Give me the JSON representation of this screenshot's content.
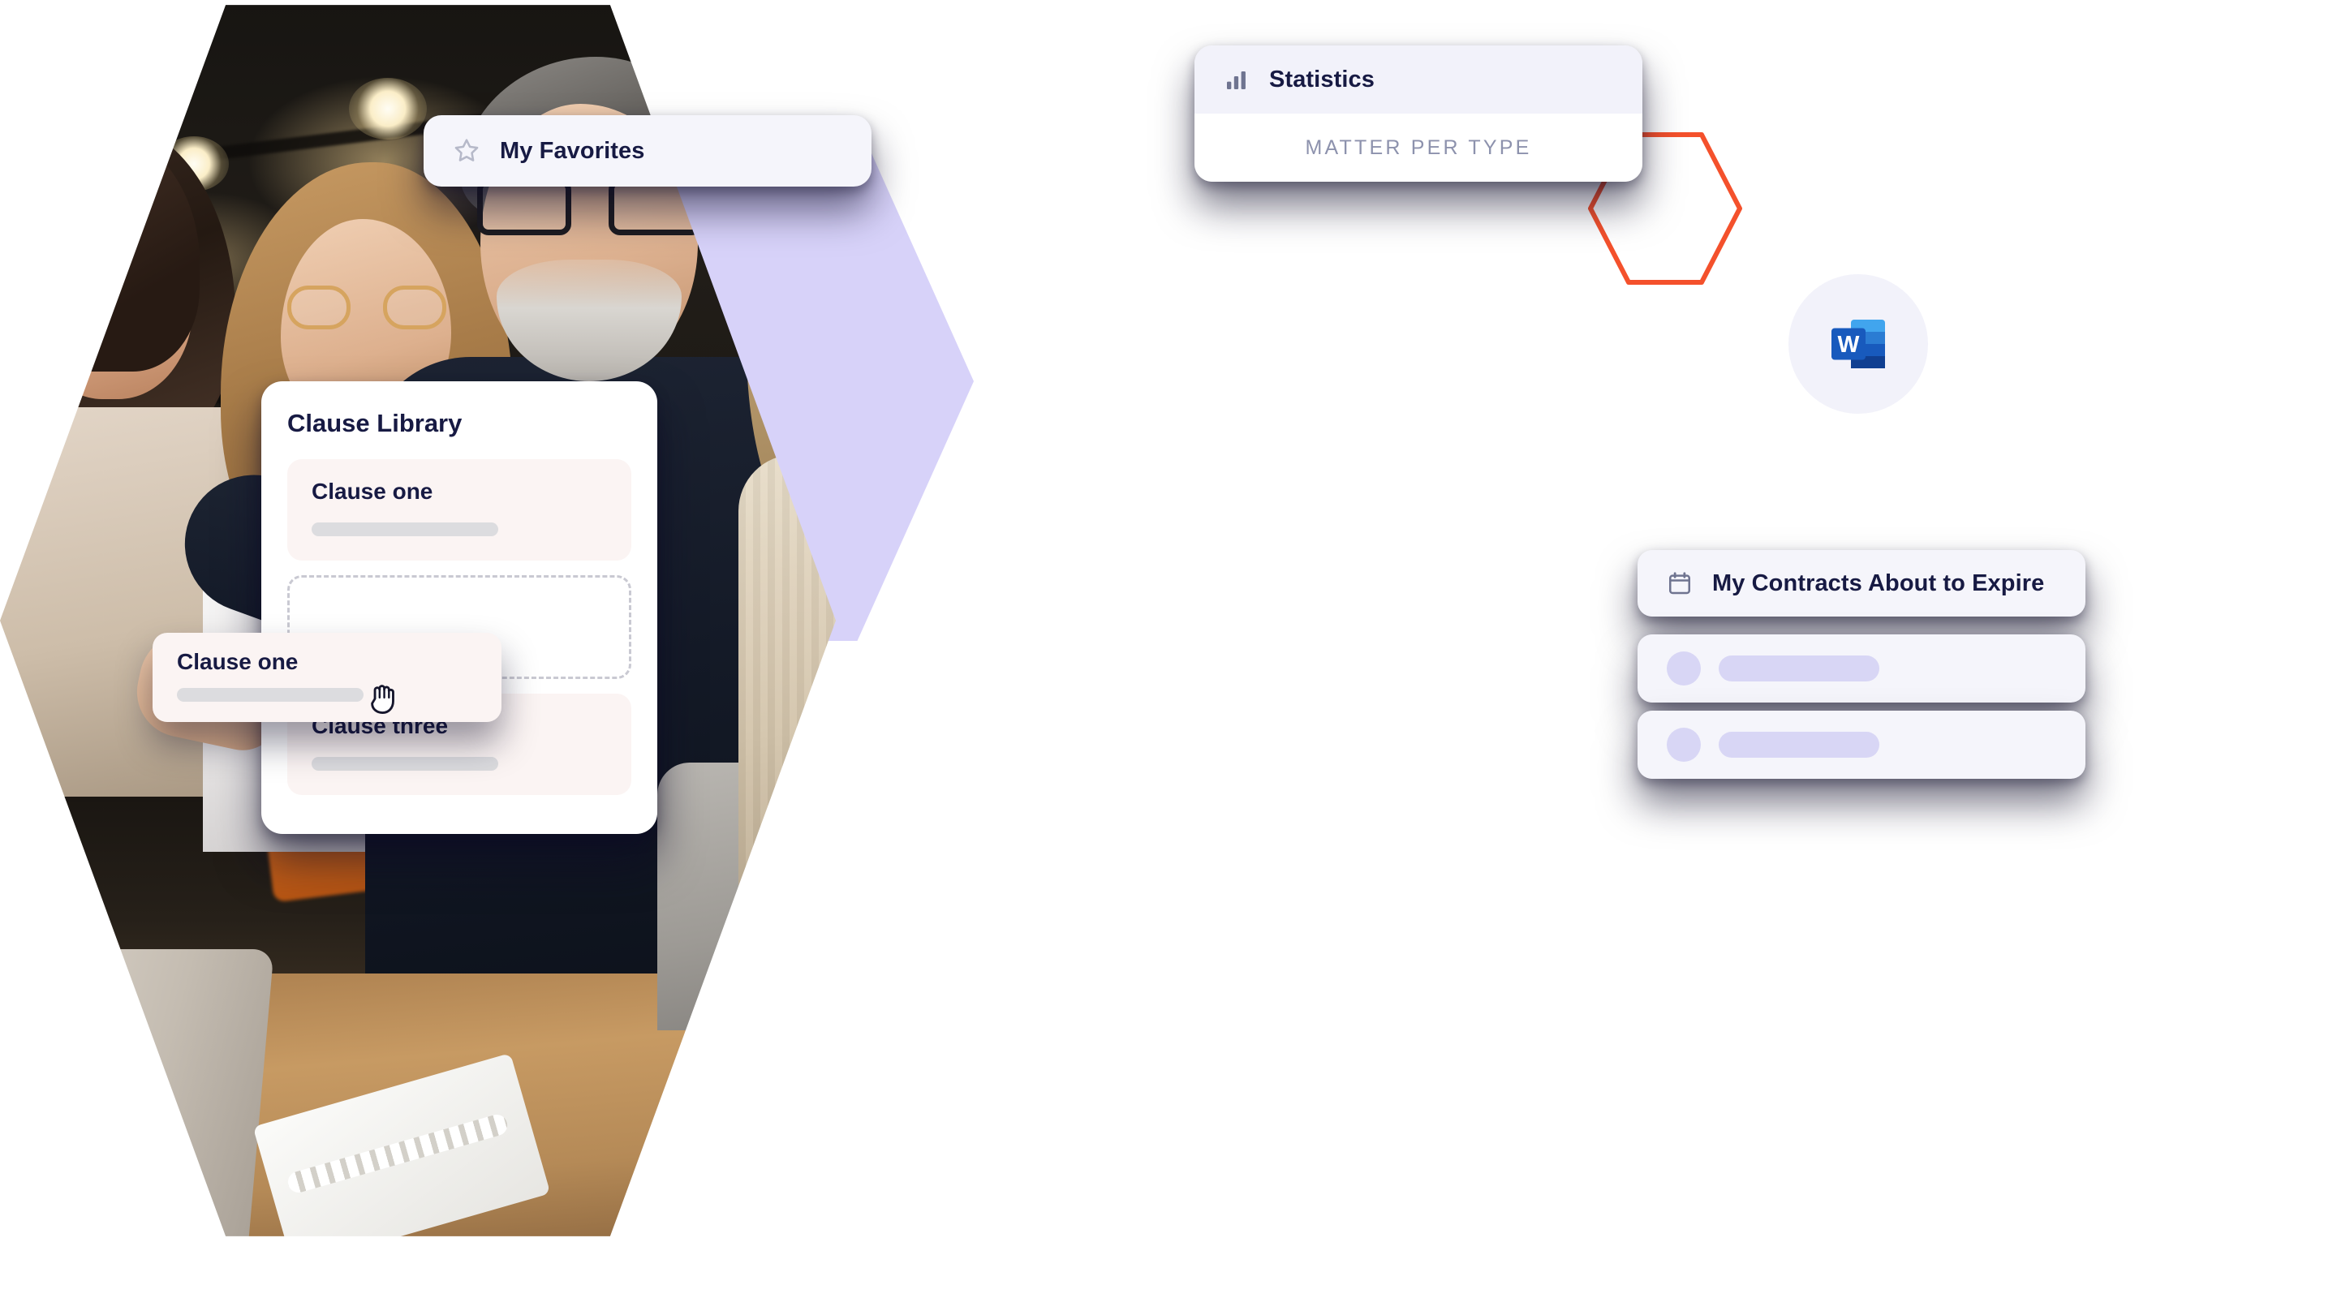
{
  "favorites_card": {
    "icon": "star-icon",
    "label": "My Favorites"
  },
  "statistics_card": {
    "icon": "bar-chart-icon",
    "title": "Statistics",
    "subtitle": "MATTER PER TYPE"
  },
  "clause_library": {
    "title": "Clause Library",
    "clauses": [
      {
        "title": "Clause one"
      },
      {
        "title": "Clause three"
      }
    ],
    "dropzone_label": ""
  },
  "dragged_clause": {
    "title": "Clause one",
    "cursor": "grab-cursor"
  },
  "contracts_card": {
    "icon": "calendar-icon",
    "title": "My Contracts About to Expire",
    "rows": [
      {
        "avatar": "avatar-placeholder",
        "pill": "text-placeholder"
      },
      {
        "avatar": "avatar-placeholder",
        "pill": "text-placeholder"
      }
    ]
  },
  "word_badge": {
    "icon": "microsoft-word-icon",
    "letter": "W"
  },
  "decorations": {
    "lavender_hexagon": "#d7d2f9",
    "red_hexagon_outline": "#f4512c",
    "photo_hexagon": "team-collaboration-photo"
  },
  "colors": {
    "card_background": "#f5f5fb",
    "panel_background": "#ffffff",
    "clause_card_background": "#fbf4f3",
    "text_primary": "#171a43",
    "text_muted": "#8d92ad",
    "skeleton_gray": "#dcdcdf",
    "accent_lavender": "#d8d6f5"
  }
}
